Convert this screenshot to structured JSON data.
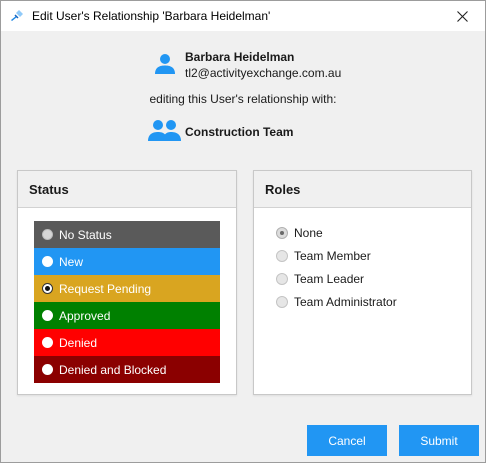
{
  "window": {
    "title": "Edit User's Relationship 'Barbara Heidelman'",
    "close_icon": "close-icon",
    "app_icon": "tools-icon"
  },
  "user": {
    "name": "Barbara Heidelman",
    "email": "tl2@activityexchange.com.au",
    "icon": "person-icon",
    "icon_color": "#2196f3"
  },
  "editing_text": "editing this User's relationship with:",
  "team": {
    "name": "Construction Team",
    "icon": "group-icon",
    "icon_color": "#2196f3"
  },
  "status_panel": {
    "title": "Status",
    "selected": "Request Pending",
    "items": [
      {
        "label": "No Status",
        "color": "#5a5a5a"
      },
      {
        "label": "New",
        "color": "#2196f3"
      },
      {
        "label": "Request Pending",
        "color": "#d9a520"
      },
      {
        "label": "Approved",
        "color": "#008000"
      },
      {
        "label": "Denied",
        "color": "#ff0000"
      },
      {
        "label": "Denied and Blocked",
        "color": "#8b0000"
      }
    ]
  },
  "roles_panel": {
    "title": "Roles",
    "selected": "None",
    "items": [
      {
        "label": "None"
      },
      {
        "label": "Team Member"
      },
      {
        "label": "Team Leader"
      },
      {
        "label": "Team Administrator"
      }
    ]
  },
  "buttons": {
    "cancel_label": "Cancel",
    "submit_label": "Submit",
    "color": "#2196f3"
  }
}
